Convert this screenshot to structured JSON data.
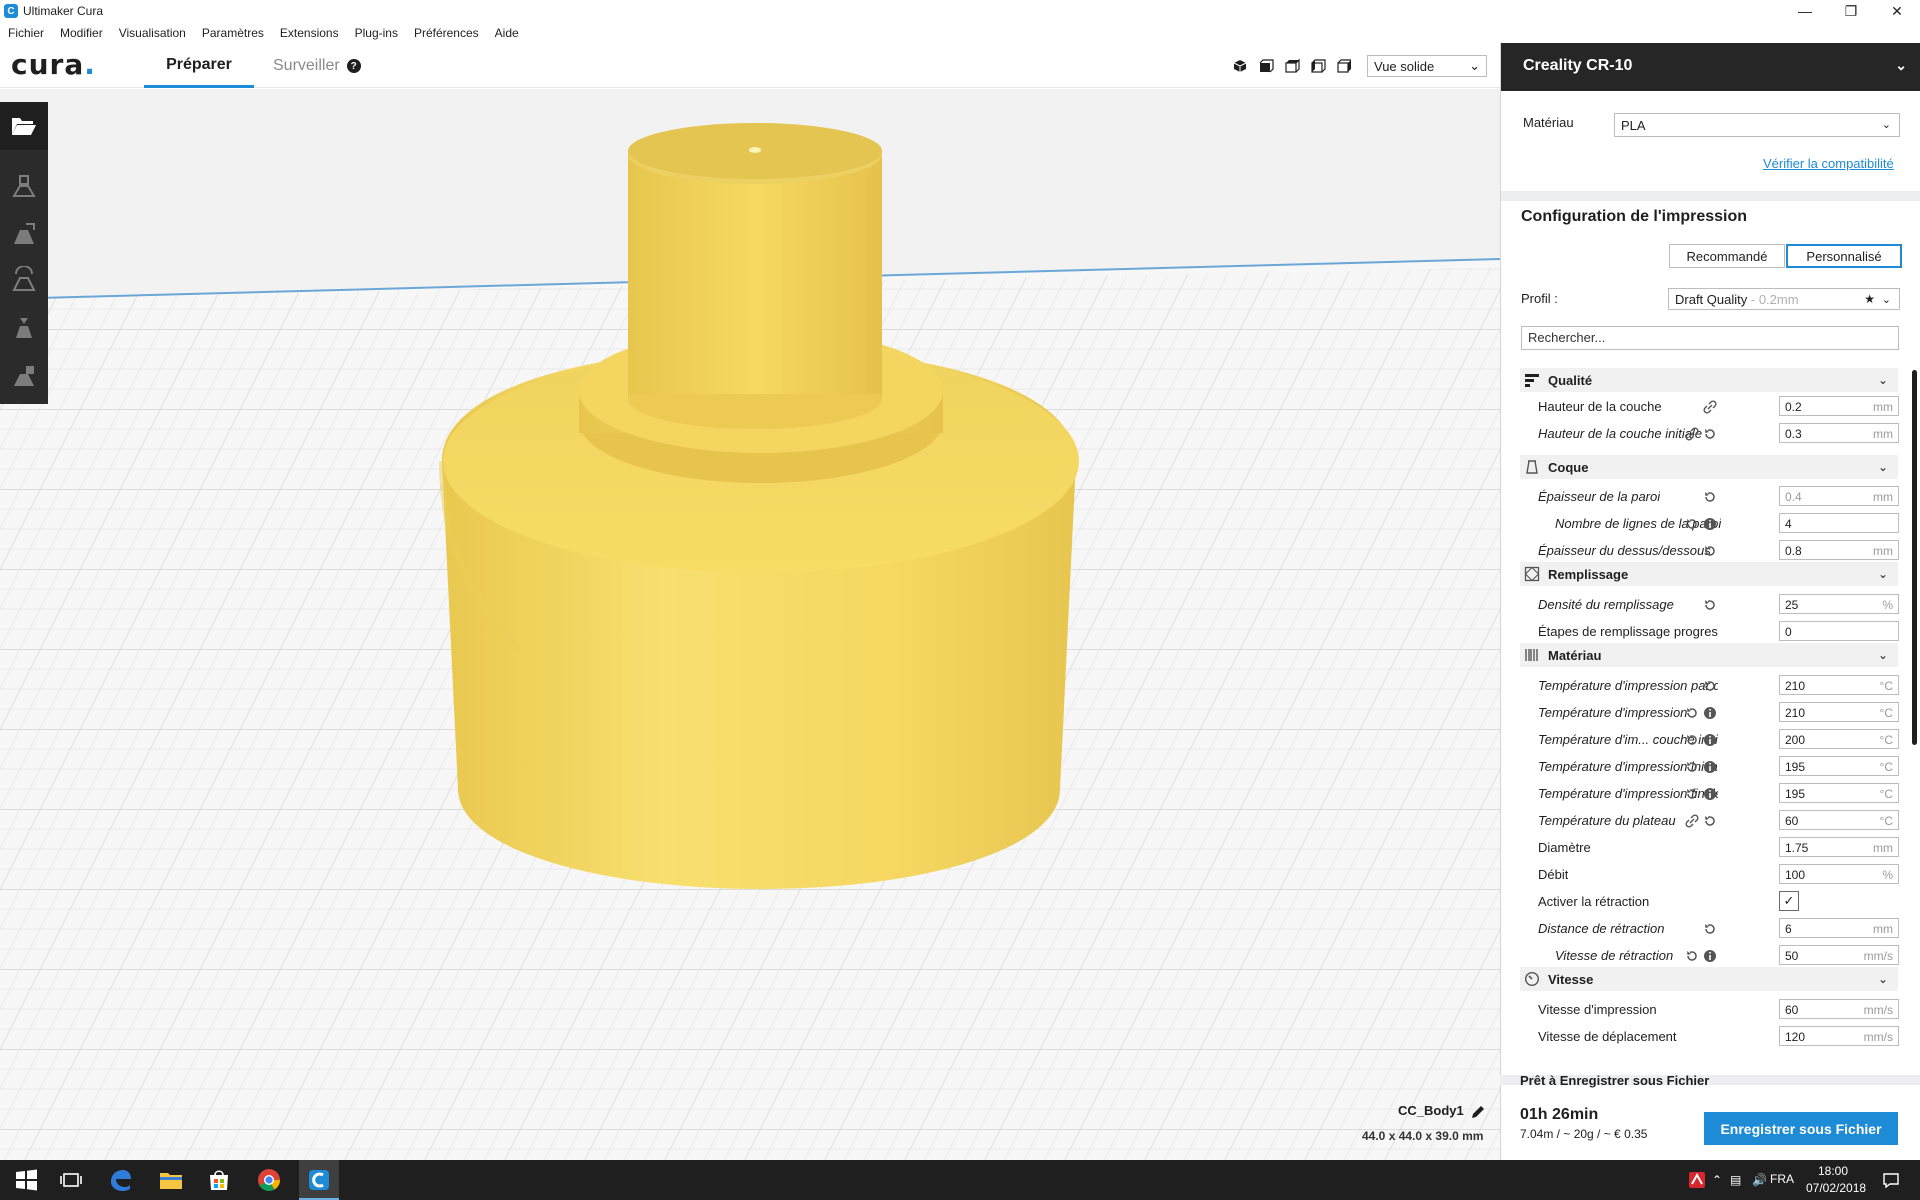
{
  "window": {
    "title": "Ultimaker Cura",
    "app_letter": "C"
  },
  "menu": [
    "Fichier",
    "Modifier",
    "Visualisation",
    "Paramètres",
    "Extensions",
    "Plug-ins",
    "Préférences",
    "Aide"
  ],
  "header": {
    "logo": "cura",
    "logo_dot": ".",
    "tabs": {
      "prepare": "Préparer",
      "monitor": "Surveiller",
      "help": "?"
    },
    "view_mode": "Vue solide"
  },
  "viewport": {
    "object_name": "CC_Body1",
    "object_size": "44.0 x 44.0 x 39.0 mm",
    "object_color": "#f6d862"
  },
  "sidebar": {
    "machine": "Creality CR-10",
    "material_label": "Matériau",
    "material_value": "PLA",
    "compat_link": "Vérifier la compatibilité",
    "config_title": "Configuration de l'impression",
    "mode_recommended": "Recommandé",
    "mode_custom": "Personnalisé",
    "profile_label": "Profil :",
    "profile_value": "Draft Quality",
    "profile_suffix": "- 0.2mm",
    "search_placeholder": "Rechercher...",
    "categories": {
      "quality": "Qualité",
      "shell": "Coque",
      "infill": "Remplissage",
      "material": "Matériau",
      "speed": "Vitesse"
    },
    "settings": {
      "layer_height": {
        "name": "Hauteur de la couche",
        "value": "0.2",
        "unit": "mm"
      },
      "initial_layer_height": {
        "name": "Hauteur de la couche initiale",
        "value": "0.3",
        "unit": "mm"
      },
      "wall_thickness": {
        "name": "Épaisseur de la paroi",
        "value": "0.4",
        "unit": "mm"
      },
      "wall_line_count": {
        "name": "Nombre de lignes de la paroi",
        "value": "4",
        "unit": ""
      },
      "top_bottom_thickness": {
        "name": "Épaisseur du dessus/dessous",
        "value": "0.8",
        "unit": "mm"
      },
      "infill_density": {
        "name": "Densité du remplissage",
        "value": "25",
        "unit": "%"
      },
      "gradual_infill": {
        "name": "Étapes de remplissage progressif",
        "value": "0",
        "unit": ""
      },
      "default_print_temp": {
        "name": "Température d'impression par défaut",
        "value": "210",
        "unit": "°C"
      },
      "print_temp": {
        "name": "Température d'impression",
        "value": "210",
        "unit": "°C"
      },
      "print_temp_initial_layer": {
        "name": "Température d'im... couche initiale",
        "value": "200",
        "unit": "°C"
      },
      "initial_print_temp": {
        "name": "Température d'impression initiale",
        "value": "195",
        "unit": "°C"
      },
      "final_print_temp": {
        "name": "Température d'impression finale",
        "value": "195",
        "unit": "°C"
      },
      "bed_temp": {
        "name": "Température du plateau",
        "value": "60",
        "unit": "°C"
      },
      "diameter": {
        "name": "Diamètre",
        "value": "1.75",
        "unit": "mm"
      },
      "flow": {
        "name": "Débit",
        "value": "100",
        "unit": "%"
      },
      "enable_retraction": {
        "name": "Activer la rétraction",
        "value": "✓"
      },
      "retraction_distance": {
        "name": "Distance de rétraction",
        "value": "6",
        "unit": "mm"
      },
      "retraction_speed": {
        "name": "Vitesse de rétraction",
        "value": "50",
        "unit": "mm/s"
      },
      "print_speed": {
        "name": "Vitesse d'impression",
        "value": "60",
        "unit": "mm/s"
      },
      "travel_speed": {
        "name": "Vitesse de déplacement",
        "value": "120",
        "unit": "mm/s"
      }
    },
    "ready": "Prêt à Enregistrer sous Fichier",
    "print_time": "01h 26min",
    "print_info": "7.04m / ~ 20g / ~ € 0.35",
    "save_button": "Enregistrer sous Fichier"
  },
  "taskbar": {
    "language": "FRA",
    "time": "18:00",
    "date": "07/02/2018"
  },
  "colors": {
    "accent": "#1e8bd6",
    "dark": "#262626"
  }
}
